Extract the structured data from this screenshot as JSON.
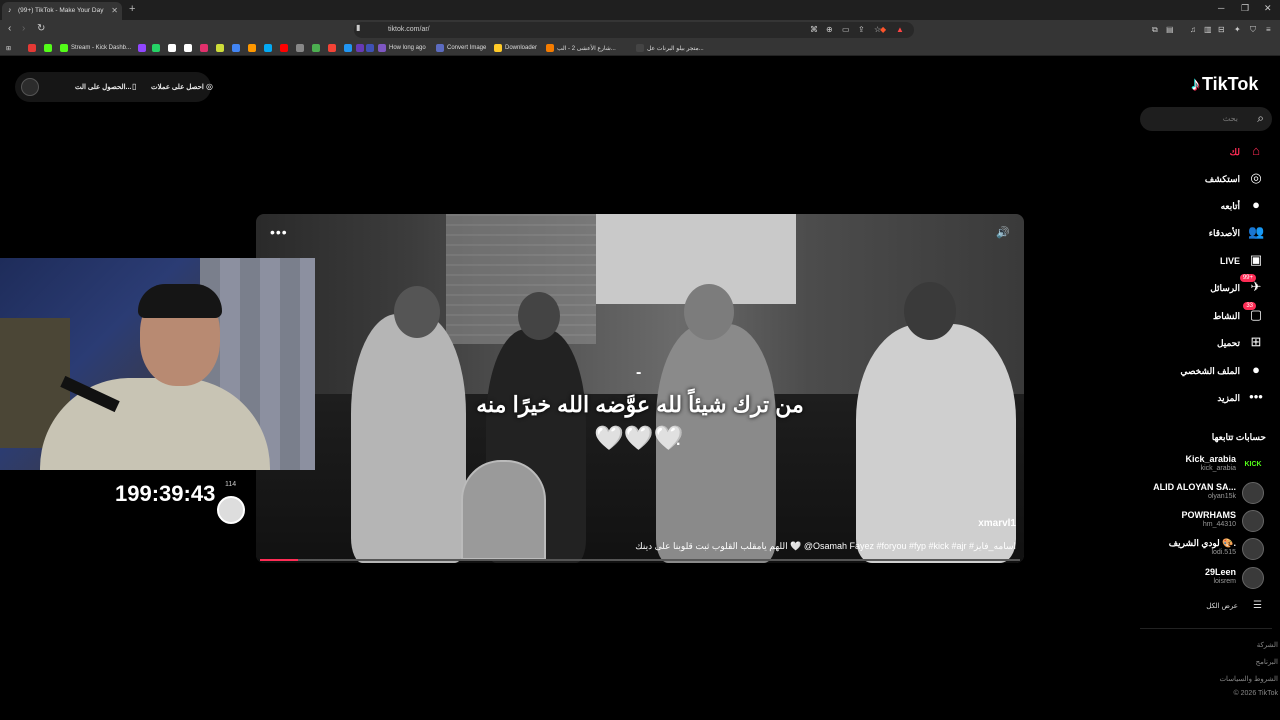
{
  "browser": {
    "tab_title": "(99+) TikTok - Make Your Day",
    "tab_close": "✕",
    "new_tab": "+",
    "window_controls": [
      "─",
      "❐",
      "✕"
    ],
    "nav": [
      "‹",
      "›",
      "↻"
    ],
    "url": "tiktok.com/ar/",
    "bookmarks": [
      {
        "label": "",
        "color": "#e53935"
      },
      {
        "label": "",
        "color": "#53fc18"
      },
      {
        "label": "Stream - Kick Dashb...",
        "color": "#53fc18"
      },
      {
        "label": "",
        "color": "#9146ff"
      },
      {
        "label": "",
        "color": "#25d366"
      },
      {
        "label": "",
        "color": "#ffffff"
      },
      {
        "label": "",
        "color": "#ffffff"
      },
      {
        "label": "",
        "color": "#e1306c"
      },
      {
        "label": "",
        "color": "#cddc39"
      },
      {
        "label": "",
        "color": "#4285f4"
      },
      {
        "label": "",
        "color": "#ff9800"
      },
      {
        "label": "",
        "color": "#03a9f4"
      },
      {
        "label": "",
        "color": "#ff0000"
      },
      {
        "label": "",
        "color": "#888888"
      },
      {
        "label": "",
        "color": "#4caf50"
      },
      {
        "label": "",
        "color": "#f44336"
      },
      {
        "label": "",
        "color": "#2196f3"
      },
      {
        "label": "",
        "color": "#673ab7"
      },
      {
        "label": "",
        "color": "#3f51b5"
      },
      {
        "label": "How long ago",
        "color": "#7e57c2"
      },
      {
        "label": "Convert Image",
        "color": "#5c6bc0"
      },
      {
        "label": "Downloader",
        "color": "#ffca28"
      },
      {
        "label": "شارع الأعشى 2 - الب...",
        "color": "#f57c00"
      },
      {
        "label": "متجر بيلو البرنات عل...",
        "color": "#444444"
      }
    ]
  },
  "promo": {
    "item1": "احصل على عملات",
    "item2": "الحصول على الت...",
    "icon1": "coin-icon",
    "icon2": "phone-icon"
  },
  "video": {
    "menu": "•••",
    "sound_icon": "🔊",
    "dash": "-",
    "caption": "من ترك شيئاً لله عوَّضه الله خيرًا منه",
    "hearts": "🤍🤍🤍",
    "dot": ".",
    "author": "xmarvl1",
    "description": "اللهم يامقلب القلوب ثبت قلوبنا على دينك 🤍 @Osamah Fayez #foryou #fyp #kick #ajr #اسامه_فايز",
    "progress": 0.05,
    "accent": "#fe2c55"
  },
  "stream": {
    "timer": "199:39:43",
    "count": "114"
  },
  "sidebar": {
    "logo": "TikTok",
    "search_placeholder": "بحث",
    "nav": [
      {
        "label": "لك",
        "icon": "⌂",
        "name": "for-you",
        "badge": "",
        "active": true
      },
      {
        "label": "استكشف",
        "icon": "◎",
        "name": "explore",
        "badge": "",
        "active": false
      },
      {
        "label": "أتابعه",
        "icon": "●",
        "name": "following",
        "badge": "",
        "active": false
      },
      {
        "label": "الأصدقاء",
        "icon": "👥",
        "name": "friends",
        "badge": "",
        "active": false
      },
      {
        "label": "LIVE",
        "icon": "▣",
        "name": "live",
        "badge": "",
        "active": false
      },
      {
        "label": "الرسائل",
        "icon": "✈",
        "name": "messages",
        "badge": "99+",
        "active": false
      },
      {
        "label": "النشاط",
        "icon": "▢",
        "name": "activity",
        "badge": "33",
        "active": false
      },
      {
        "label": "تحميل",
        "icon": "⊞",
        "name": "upload",
        "badge": "",
        "active": false
      },
      {
        "label": "الملف الشخصي",
        "icon": "●",
        "name": "profile",
        "badge": "",
        "active": false
      },
      {
        "label": "المزيد",
        "icon": "•••",
        "name": "more",
        "badge": "",
        "active": false
      }
    ],
    "following_title": "حسابات تتابعها",
    "accounts": [
      {
        "name": "Kick_arabia",
        "user": "kick_arabia",
        "avatar": "KICK"
      },
      {
        "name": "ALID ALOYAN SA...",
        "user": "olyan15k",
        "avatar": ""
      },
      {
        "name": "POWRHAMS",
        "user": "hm_44310",
        "avatar": ""
      },
      {
        "name": "لودي الشريف 🎨.",
        "user": "lodi.515",
        "avatar": ""
      },
      {
        "name": "29Leen",
        "user": "loisrem",
        "avatar": ""
      }
    ],
    "see_all": "عرض الكل",
    "footer": [
      "الشركة",
      "البرنامج",
      "الشروط والسياسات",
      "© 2026 TikTok"
    ]
  }
}
